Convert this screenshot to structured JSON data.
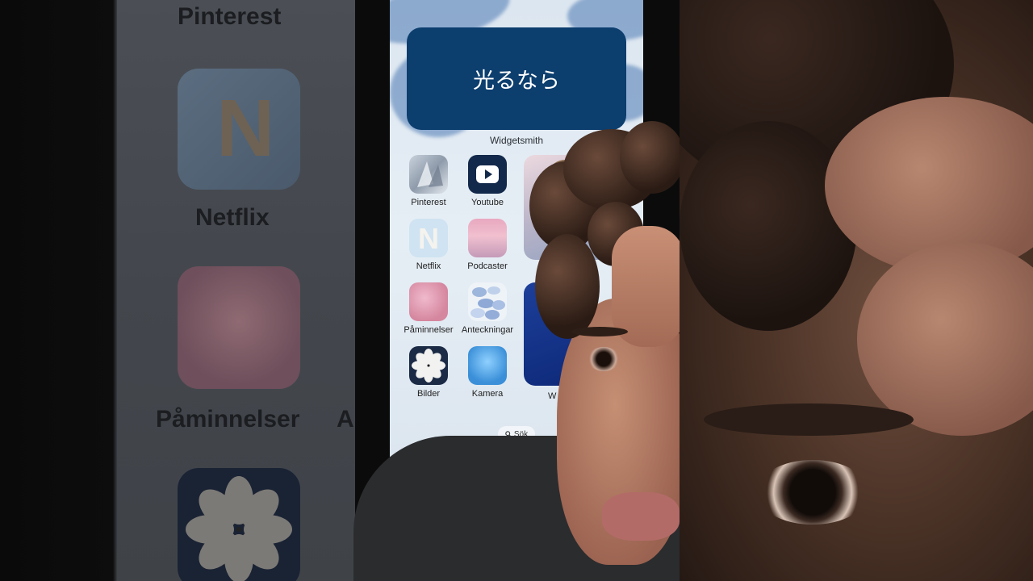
{
  "widget": {
    "text": "光るなら",
    "caption": "Widgetsmith"
  },
  "apps": [
    {
      "label": "Pinterest",
      "icon": "pinterest-crystal-icon"
    },
    {
      "label": "Youtube",
      "icon": "youtube-play-icon"
    },
    {
      "label": "Netflix",
      "icon": "netflix-n-icon"
    },
    {
      "label": "Podcaster",
      "icon": "podcast-pink-sky-icon"
    },
    {
      "label": "Påminnelser",
      "icon": "reminders-pink-crystal-icon"
    },
    {
      "label": "Anteckningar",
      "icon": "notes-pills-icon"
    },
    {
      "label": "Bilder",
      "icon": "photos-flower-icon"
    },
    {
      "label": "Kamera",
      "icon": "camera-blue-ice-icon"
    }
  ],
  "partial_label": "W",
  "search": {
    "label": "Sök",
    "icon": "search-icon"
  },
  "background_left": {
    "labels": [
      "Pinterest",
      "Netflix",
      "Påminnelser",
      "A"
    ]
  },
  "colors": {
    "widget": "#0c3e6e",
    "wallpaper": "#dce6f0"
  }
}
